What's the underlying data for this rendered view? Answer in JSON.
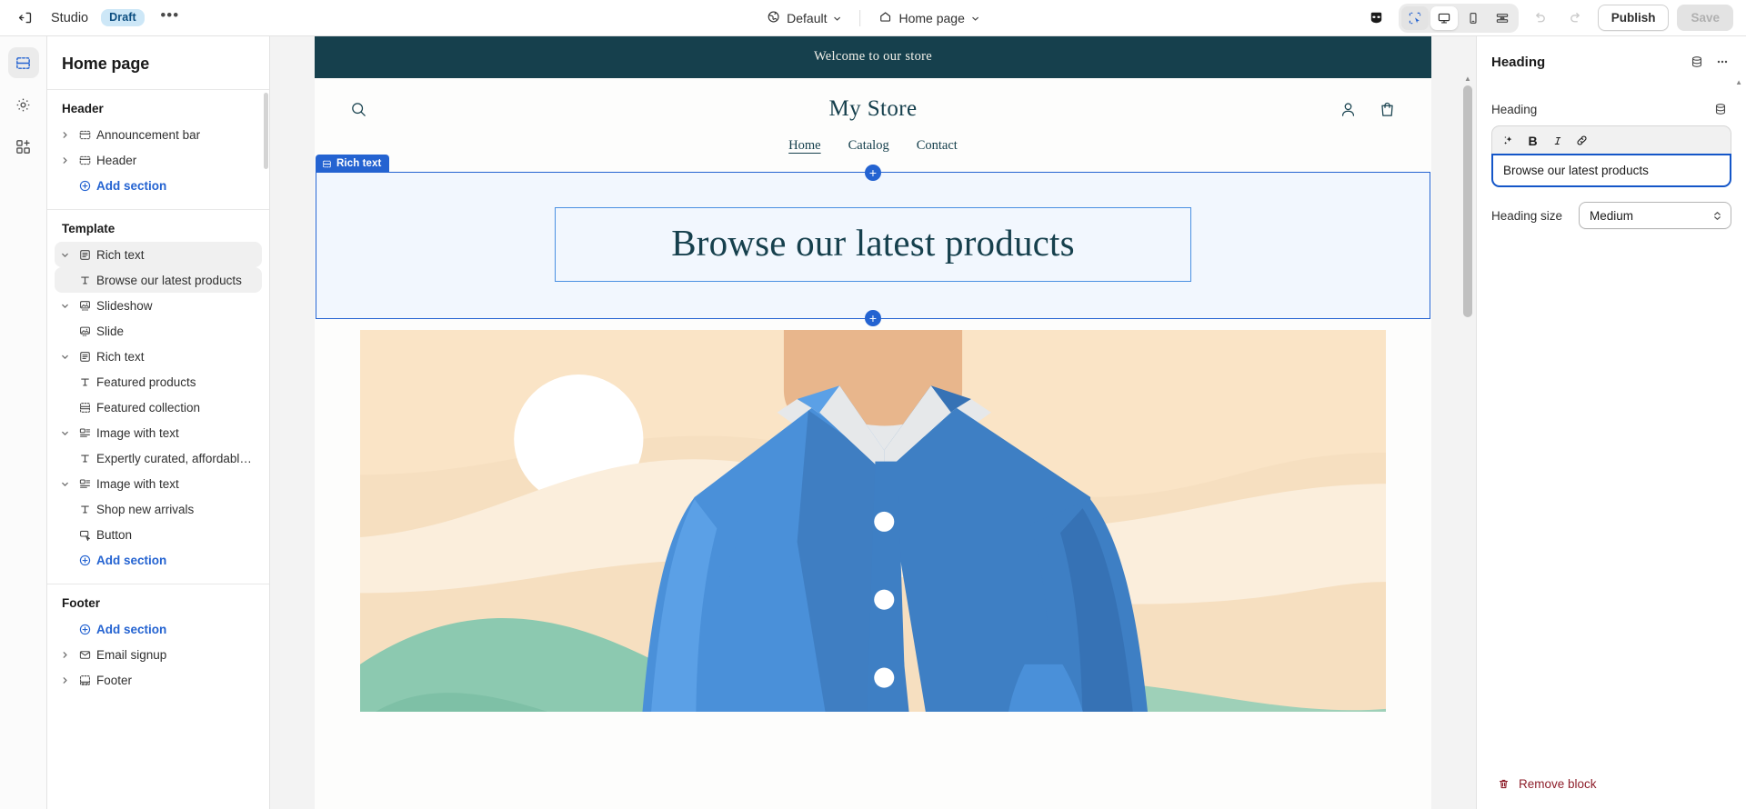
{
  "topbar": {
    "exit_icon": "exit-icon",
    "app_name": "Studio",
    "status_badge": "Draft",
    "more_label": "•••",
    "theme_icon": "globe-icon",
    "theme_name": "Default",
    "page_icon": "home-icon",
    "page_name": "Home page",
    "inspector_icon": "mask-icon",
    "tool_select_icon": "select-cursor-icon",
    "device_desktop_icon": "desktop-icon",
    "device_mobile_icon": "mobile-icon",
    "device_fullwidth_icon": "fullwidth-icon",
    "undo_icon": "undo-icon",
    "redo_icon": "redo-icon",
    "publish_label": "Publish",
    "save_label": "Save"
  },
  "rail": {
    "items": [
      {
        "name": "sections",
        "icon": "sections-icon",
        "active": true
      },
      {
        "name": "settings",
        "icon": "gear-icon",
        "active": false
      },
      {
        "name": "apps",
        "icon": "apps-add-icon",
        "active": false
      }
    ]
  },
  "sidebar": {
    "title": "Home page",
    "groups": [
      {
        "title": "Header",
        "rows": [
          {
            "label": "Announcement bar",
            "icon": "section-icon",
            "caret": "right",
            "indent": false,
            "selected": false,
            "link": false
          },
          {
            "label": "Header",
            "icon": "section-icon",
            "caret": "right",
            "indent": false,
            "selected": false,
            "link": false
          },
          {
            "label": "Add section",
            "icon": "plus-circle-icon",
            "caret": "none",
            "indent": true,
            "selected": false,
            "link": true
          }
        ]
      },
      {
        "title": "Template",
        "rows": [
          {
            "label": "Rich text",
            "icon": "rich-text-icon",
            "caret": "down",
            "indent": false,
            "selected": true,
            "link": false
          },
          {
            "label": "Browse our latest products",
            "icon": "text-icon",
            "caret": "none",
            "indent": true,
            "selected": true,
            "link": false
          },
          {
            "label": "Slideshow",
            "icon": "slideshow-icon",
            "caret": "down",
            "indent": false,
            "selected": false,
            "link": false
          },
          {
            "label": "Slide",
            "icon": "image-icon",
            "caret": "none",
            "indent": true,
            "selected": false,
            "link": false
          },
          {
            "label": "Rich text",
            "icon": "rich-text-icon",
            "caret": "down",
            "indent": false,
            "selected": false,
            "link": false
          },
          {
            "label": "Featured products",
            "icon": "text-icon",
            "caret": "none",
            "indent": true,
            "selected": false,
            "link": false
          },
          {
            "label": "Featured collection",
            "icon": "collection-icon",
            "caret": "none",
            "indent": false,
            "selected": false,
            "link": false
          },
          {
            "label": "Image with text",
            "icon": "image-with-text-icon",
            "caret": "down",
            "indent": false,
            "selected": false,
            "link": false
          },
          {
            "label": "Expertly curated, affordably pri...",
            "icon": "text-icon",
            "caret": "none",
            "indent": true,
            "selected": false,
            "link": false
          },
          {
            "label": "Image with text",
            "icon": "image-with-text-icon",
            "caret": "down",
            "indent": false,
            "selected": false,
            "link": false
          },
          {
            "label": "Shop new arrivals",
            "icon": "text-icon",
            "caret": "none",
            "indent": true,
            "selected": false,
            "link": false
          },
          {
            "label": "Button",
            "icon": "button-icon",
            "caret": "none",
            "indent": true,
            "selected": false,
            "link": false
          },
          {
            "label": "Add section",
            "icon": "plus-circle-icon",
            "caret": "none",
            "indent": true,
            "selected": false,
            "link": true
          }
        ]
      },
      {
        "title": "Footer",
        "rows": [
          {
            "label": "Add section",
            "icon": "plus-circle-icon",
            "caret": "none",
            "indent": true,
            "selected": false,
            "link": true
          },
          {
            "label": "Email signup",
            "icon": "email-icon",
            "caret": "right",
            "indent": false,
            "selected": false,
            "link": false
          },
          {
            "label": "Footer",
            "icon": "footer-icon",
            "caret": "right",
            "indent": false,
            "selected": false,
            "link": false
          }
        ]
      }
    ]
  },
  "preview": {
    "announcement": "Welcome to our store",
    "logo": "My Store",
    "search_icon": "search-icon",
    "account_icon": "account-icon",
    "cart_icon": "cart-icon",
    "nav": [
      {
        "label": "Home",
        "current": true
      },
      {
        "label": "Catalog",
        "current": false
      },
      {
        "label": "Contact",
        "current": false
      }
    ],
    "selected_section_badge": "Rich text",
    "selected_section_badge_icon": "section-icon",
    "hero_heading": "Browse our latest products",
    "add_block_icon": "plus-icon"
  },
  "panel": {
    "title": "Heading",
    "header_icons": [
      "database-icon",
      "more-horizontal-icon"
    ],
    "field_label": "Heading",
    "field_side_icon": "database-icon",
    "toolbar_buttons": [
      {
        "name": "ai-sparkle",
        "glyph": "✦"
      },
      {
        "name": "bold",
        "glyph": "B"
      },
      {
        "name": "italic",
        "glyph": "I"
      },
      {
        "name": "link",
        "glyph": "🔗"
      }
    ],
    "heading_value": "Browse our latest products",
    "size_label": "Heading size",
    "size_value": "Medium",
    "remove_label": "Remove block",
    "remove_icon": "trash-icon"
  },
  "colors": {
    "accent_blue": "#2463d1",
    "focus_blue": "#1456c8",
    "store_dark": "#16404d",
    "draft_badge_bg": "#cde7f7",
    "remove_red": "#8e1f2b",
    "selection_tint": "#f2f7fe"
  }
}
